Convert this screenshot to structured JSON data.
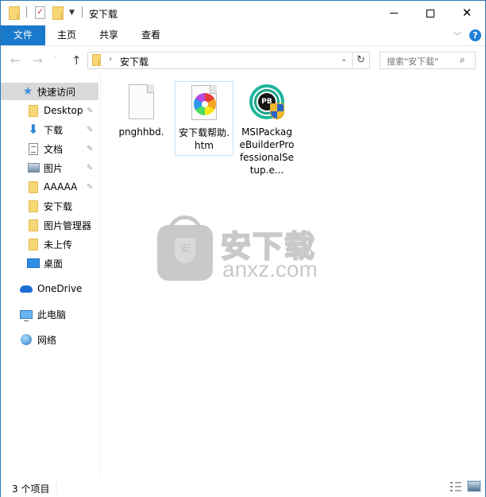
{
  "window": {
    "title": "安下载",
    "controls": {
      "minimize": "minimize",
      "maximize": "maximize",
      "close": "close"
    }
  },
  "quick_access_toolbar": {
    "icons": [
      "folder-icon",
      "properties-icon",
      "new-folder-icon",
      "customize-dropdown-icon"
    ]
  },
  "ribbon": {
    "tabs": [
      {
        "label": "文件",
        "active": true
      },
      {
        "label": "主页"
      },
      {
        "label": "共享"
      },
      {
        "label": "查看"
      }
    ],
    "expand_glyph": "﹀",
    "help_glyph": "?"
  },
  "navigation": {
    "back_glyph": "←",
    "forward_glyph": "→",
    "recent_glyph": "˅",
    "up_glyph": "↑",
    "address": {
      "separator_glyph": "›",
      "path": "安下载",
      "dropdown_glyph": "⌄"
    },
    "refresh_glyph": "↻",
    "search": {
      "placeholder": "搜索\"安下载\"",
      "icon_glyph": "⚲"
    }
  },
  "sidebar": {
    "quick_access": {
      "label": "快速访问",
      "icon": "star-icon"
    },
    "items": [
      {
        "label": "Desktop",
        "icon": "folder-icon",
        "pinned": true
      },
      {
        "label": "下载",
        "icon": "download-icon",
        "pinned": true
      },
      {
        "label": "文档",
        "icon": "document-icon",
        "pinned": true
      },
      {
        "label": "图片",
        "icon": "pictures-icon",
        "pinned": true
      },
      {
        "label": "AAAAA",
        "icon": "folder-icon",
        "pinned": true
      },
      {
        "label": "安下载",
        "icon": "folder-icon",
        "pinned": false
      },
      {
        "label": "图片管理器",
        "icon": "folder-icon",
        "pinned": false
      },
      {
        "label": "未上传",
        "icon": "folder-icon",
        "pinned": false
      },
      {
        "label": "桌面",
        "icon": "desktop-icon",
        "pinned": false
      }
    ],
    "pin_glyph": "📌",
    "onedrive": {
      "label": "OneDrive",
      "icon": "onedrive-icon"
    },
    "this_pc": {
      "label": "此电脑",
      "icon": "computer-icon"
    },
    "network": {
      "label": "网络",
      "icon": "network-icon"
    }
  },
  "files": [
    {
      "name": "pnghhbd.",
      "type": "blank-file",
      "selected": false
    },
    {
      "name": "安下载帮助.htm",
      "type": "htm-file",
      "selected": true
    },
    {
      "name": "MSIPackageBuilderProfessionalSetup.e...",
      "type": "installer-exe",
      "selected": false,
      "badge": "PB"
    }
  ],
  "watermark": {
    "cn": "安下载",
    "en": "anxz.com",
    "shield_char": "安"
  },
  "status": {
    "item_count": "3 个项目"
  }
}
